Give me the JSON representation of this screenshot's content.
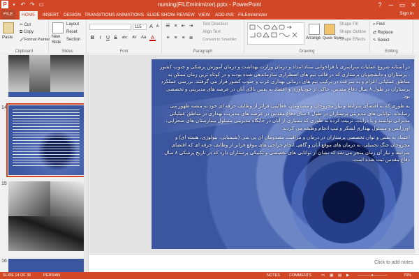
{
  "titlebar": {
    "title": "nursing(FILEminimizer).pptx - PowerPoint",
    "qat_icons": [
      "powerpoint-icon",
      "save-icon",
      "undo-icon",
      "redo-icon",
      "present-icon"
    ],
    "min": "─",
    "restore": "▭",
    "close": "✕",
    "help": "?"
  },
  "tabs": {
    "file": "FILE",
    "items": [
      "HOME",
      "INSERT",
      "DESIGN",
      "TRANSITIONS",
      "ANIMATIONS",
      "SLIDE SHOW",
      "REVIEW",
      "VIEW",
      "ADD-INS",
      "FILEminimizer"
    ],
    "signin": "Sign in"
  },
  "ribbon": {
    "clipboard": {
      "label": "Clipboard",
      "paste": "Paste",
      "cut": "Cut",
      "copy": "Copy",
      "format_painter": "Format Painter"
    },
    "slides": {
      "label": "Slides",
      "new_slide": "New",
      "new_slide2": "Slide",
      "layout": "Layout",
      "reset": "Reset",
      "section": "Section"
    },
    "font": {
      "label": "Font",
      "font_name": "",
      "font_size": "115",
      "bold": "B",
      "italic": "I",
      "underline": "U",
      "strike": "S",
      "shadow": "abc",
      "spacing": "AV",
      "case": "Aa",
      "color": "A",
      "grow": "A",
      "shrink": "A",
      "clear": "A"
    },
    "paragraph": {
      "label": "Paragraph",
      "text_direction": "Text Direction",
      "align_text": "Align Text",
      "smartart": "Convert to SmartArt"
    },
    "drawing": {
      "label": "Drawing",
      "arrange": "Arrange",
      "quick_styles": "Quick Styles",
      "shape_fill": "Shape Fill",
      "shape_outline": "Shape Outline",
      "shape_effects": "Shape Effects"
    },
    "editing": {
      "label": "Editing",
      "find": "Find",
      "replace": "Replace",
      "select": "Select"
    }
  },
  "thumbnails": {
    "slide14": "14",
    "slide15": "15",
    "slide16": "16"
  },
  "slide": {
    "para1": "در آستانه شروع عملیات سراسری با فراخوانی ستاد امداد و درمان وزارت بهداشت و درمان آموزش پزشکی و جنوب کشور ، پرستاران و دانشجویان پرستاری که در قالب تیم های اضطراری سازماندهی شده بودند و در کوتاه ترین زمان ممکن به مناطق عملیاتی اعزام و به سرعت در ترکیب تیم های درمانی بهداری غرب و جنوب کشور قرار می گرفتند. بررسی عملکرد پرستاران در طول ۸ سال دفاع مقدس، حاکی از خودباوری و اعتماد به نفس بالای آنان در عرصه های مدیریتی و تخصصی بود.",
    "para2": "به طوری که به اقتضای شرایط و نیاز مجروحان و مصدومان، فعالیتی فراتر از وظایف حرفه ای خود به منصه ظهور می رساندند. توانایی های مدیریتی پرستاران در طول ۸ سال دفاع مقدس در عرصه های مدیریت بهداری در مناطق عملیاتی مدیرانی توانمند و با درایت، تربیت کرده به طوری که بسیاری از آنان در جایگاه مدیریتی مسئول بیمارستان های صحرایی، اورژانس و مسئول بهداری لشکر و تیپ انجام وظیفه می کردند.",
    "para3": "اعتماد به نفس و توان تخصصی پرستاران در درمان و مراقبت مصدومان ان پی سی (شیمیایی، بیولوژی، هسته ای) و مجروحان جنگ تحمیلی، به درمان های موقع آنان و گاهی انجام جراحی های موقع فراتر از وظایف حرفه ای که اقتضای شرایط و نیاز آن زمان منجر می شد که نشان از توانایی های تخصصی و تکنیکی پرستاران دارد که در تاریخ پزشکی ۸ سال دفاع مقدس ثبت شده است."
  },
  "notes": {
    "placeholder": "Click to add notes"
  },
  "status": {
    "slide": "SLIDE 14 OF 36",
    "language": "PERSIAN",
    "notes": "NOTES",
    "comments": "COMMENTS",
    "zoom": "70%"
  }
}
